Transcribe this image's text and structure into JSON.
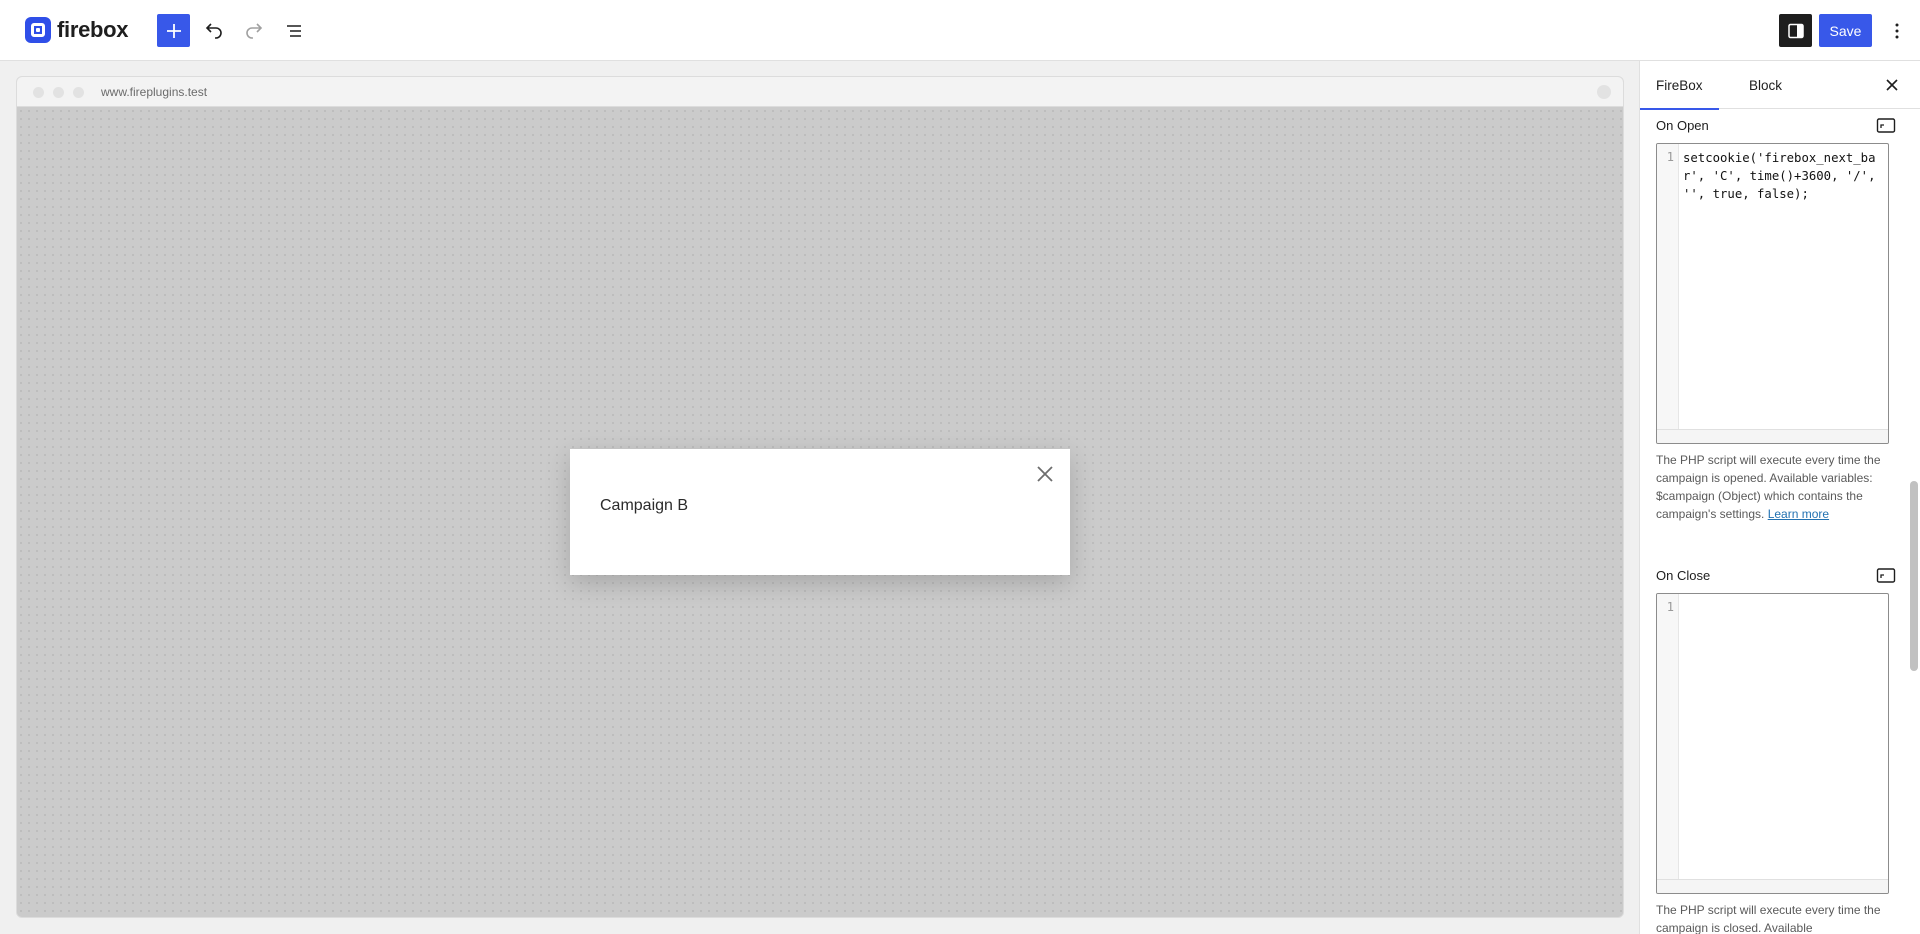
{
  "app": {
    "name": "firebox"
  },
  "toolbar": {
    "save_label": "Save",
    "icons": {
      "add": "plus-icon",
      "undo": "undo-icon",
      "redo": "redo-icon",
      "list_view": "list-view-icon",
      "settings": "sidebar-toggle-icon",
      "more": "more-vertical-icon"
    },
    "accent_color": "#3858e9"
  },
  "canvas": {
    "url": "www.fireplugins.test",
    "popup": {
      "title": "Campaign B"
    }
  },
  "sidebar": {
    "tabs": [
      {
        "label": "FireBox",
        "active": true
      },
      {
        "label": "Block",
        "active": false
      }
    ],
    "on_open": {
      "label": "On Open",
      "line_number": "1",
      "code": "setcookie('firebox_next_bar', 'C', time()+3600, '/', '', true, false);",
      "help_text": "The PHP script will execute every time the campaign is opened. Available variables: $campaign (Object) which contains the campaign's settings.",
      "help_link": "Learn more"
    },
    "on_close": {
      "label": "On Close",
      "line_number": "1",
      "code": "",
      "help_text": "The PHP script will execute every time the campaign is closed. Available"
    }
  }
}
